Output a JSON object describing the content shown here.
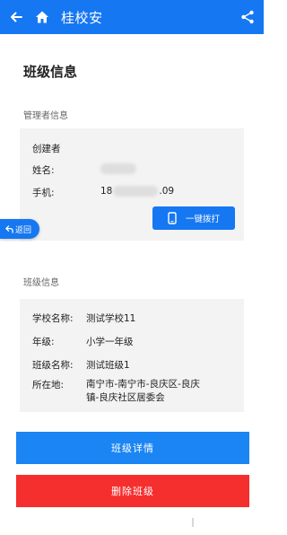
{
  "appbar": {
    "title": "桂校安"
  },
  "page": {
    "title": "班级信息"
  },
  "admin": {
    "section_label": "管理者信息",
    "creator_label": "创建者",
    "name_label": "姓名:",
    "phone_label": "手机:",
    "phone_prefix": "18",
    "phone_suffix": ".09",
    "call_button": "一键拨打"
  },
  "float_back": {
    "label": "返回"
  },
  "school": {
    "section_label": "班级信息",
    "fields": [
      {
        "label": "学校名称:",
        "value": "测试学校11"
      },
      {
        "label": "年级:",
        "value": "小学一年级"
      },
      {
        "label": "班级名称:",
        "value": "测试班级1"
      },
      {
        "label": "所在地:",
        "value_line1": "南宁市-南宁市-良庆区-良庆",
        "value_line2": "镇-良庆社区居委会"
      }
    ]
  },
  "buttons": {
    "detail": "班级详情",
    "delete": "删除班级"
  },
  "colors": {
    "primary": "#1677f2",
    "danger": "#f52e2e",
    "card_bg": "#f3f3f3"
  }
}
